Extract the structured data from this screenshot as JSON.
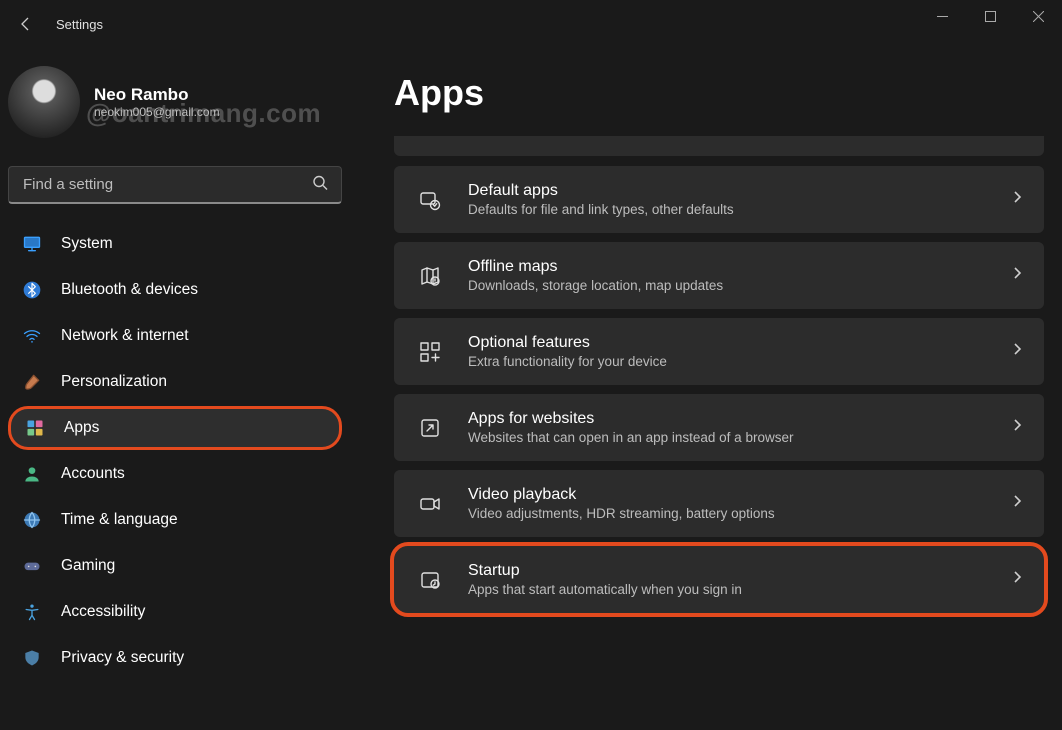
{
  "titlebar": {
    "title": "Settings"
  },
  "profile": {
    "name": "Neo Rambo",
    "email": "neokim005@gmail.com",
    "watermark": "@oantrimang.com"
  },
  "search": {
    "placeholder": "Find a setting"
  },
  "sidebar": {
    "items": [
      {
        "id": "system",
        "label": "System",
        "icon": "monitor"
      },
      {
        "id": "bluetooth",
        "label": "Bluetooth & devices",
        "icon": "bluetooth"
      },
      {
        "id": "network",
        "label": "Network & internet",
        "icon": "wifi"
      },
      {
        "id": "personalization",
        "label": "Personalization",
        "icon": "brush"
      },
      {
        "id": "apps",
        "label": "Apps",
        "icon": "apps",
        "selected": true,
        "highlighted": true
      },
      {
        "id": "accounts",
        "label": "Accounts",
        "icon": "person"
      },
      {
        "id": "time",
        "label": "Time & language",
        "icon": "globe"
      },
      {
        "id": "gaming",
        "label": "Gaming",
        "icon": "gamepad"
      },
      {
        "id": "accessibility",
        "label": "Accessibility",
        "icon": "accessibility"
      },
      {
        "id": "privacy",
        "label": "Privacy & security",
        "icon": "shield"
      }
    ]
  },
  "main": {
    "title": "Apps",
    "cards": [
      {
        "id": "default-apps",
        "title": "Default apps",
        "sub": "Defaults for file and link types, other defaults",
        "icon": "default-apps"
      },
      {
        "id": "offline-maps",
        "title": "Offline maps",
        "sub": "Downloads, storage location, map updates",
        "icon": "map"
      },
      {
        "id": "optional-features",
        "title": "Optional features",
        "sub": "Extra functionality for your device",
        "icon": "grid-plus"
      },
      {
        "id": "apps-websites",
        "title": "Apps for websites",
        "sub": "Websites that can open in an app instead of a browser",
        "icon": "open-app"
      },
      {
        "id": "video-playback",
        "title": "Video playback",
        "sub": "Video adjustments, HDR streaming, battery options",
        "icon": "video"
      },
      {
        "id": "startup",
        "title": "Startup",
        "sub": "Apps that start automatically when you sign in",
        "icon": "startup",
        "highlighted": true
      }
    ]
  },
  "colors": {
    "highlight": "#e34a1e"
  }
}
